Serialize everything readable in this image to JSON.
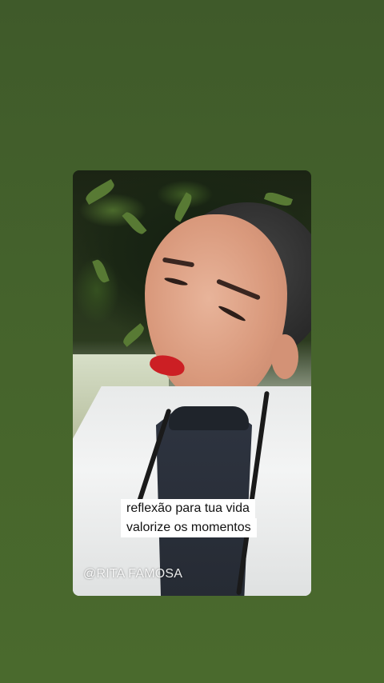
{
  "story": {
    "media_description_icon": "photo",
    "caption_lines": [
      "reflexão para tua vida",
      "valorize os momentos"
    ],
    "watermark": "@RITA FAMOSA"
  },
  "colors": {
    "background_top": "#3f5a2a",
    "background_bottom": "#4a6a2d",
    "caption_bg": "#ffffff",
    "caption_text": "#111111",
    "lip_color": "#cc1f24"
  }
}
